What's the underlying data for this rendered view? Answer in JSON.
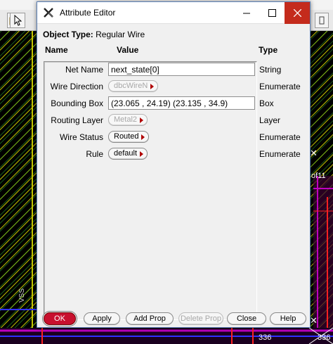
{
  "background": {
    "side_label": "VSS",
    "right_labels": [
      "of11",
      "336",
      "336"
    ]
  },
  "dialog": {
    "title": "Attribute Editor",
    "object_type_label": "Object Type:",
    "object_type_value": "Regular Wire",
    "columns": {
      "name": "Name",
      "value": "Value",
      "type": "Type"
    },
    "properties": [
      {
        "name": "Net Name",
        "value": "next_state[0]",
        "type": "String",
        "control": "text",
        "enabled": true
      },
      {
        "name": "Wire Direction",
        "value": "dbcWireN",
        "type": "Enumerate",
        "control": "cycle",
        "enabled": false
      },
      {
        "name": "Bounding Box",
        "value": "(23.065 , 24.19) (23.135 , 34.9)",
        "type": "Box",
        "control": "text",
        "enabled": true
      },
      {
        "name": "Routing Layer",
        "value": "Metal2",
        "type": "Layer",
        "control": "cycle",
        "enabled": false
      },
      {
        "name": "Wire Status",
        "value": "Routed",
        "type": "Enumerate",
        "control": "cycle",
        "enabled": true
      },
      {
        "name": "Rule",
        "value": "default",
        "type": "Enumerate",
        "control": "cycle",
        "enabled": true
      }
    ],
    "buttons": {
      "ok": "OK",
      "apply": "Apply",
      "add_prop": "Add Prop",
      "delete_prop": "Delete Prop",
      "close": "Close",
      "help": "Help"
    }
  },
  "colors": {
    "canvas": "#000000",
    "ok_button": "#c8102e",
    "title_close": "#c42b1c",
    "wire_yellow": "#c8c800",
    "wire_green": "#2fa82f",
    "wire_magenta": "#c000c0",
    "wire_red": "#ff2020",
    "wire_blue": "#3030ff"
  },
  "icons": {
    "app": "x-app-icon",
    "minimize": "minimize-icon",
    "maximize": "maximize-icon",
    "close": "close-icon",
    "cycle_arrow": "triangle-right-icon"
  }
}
